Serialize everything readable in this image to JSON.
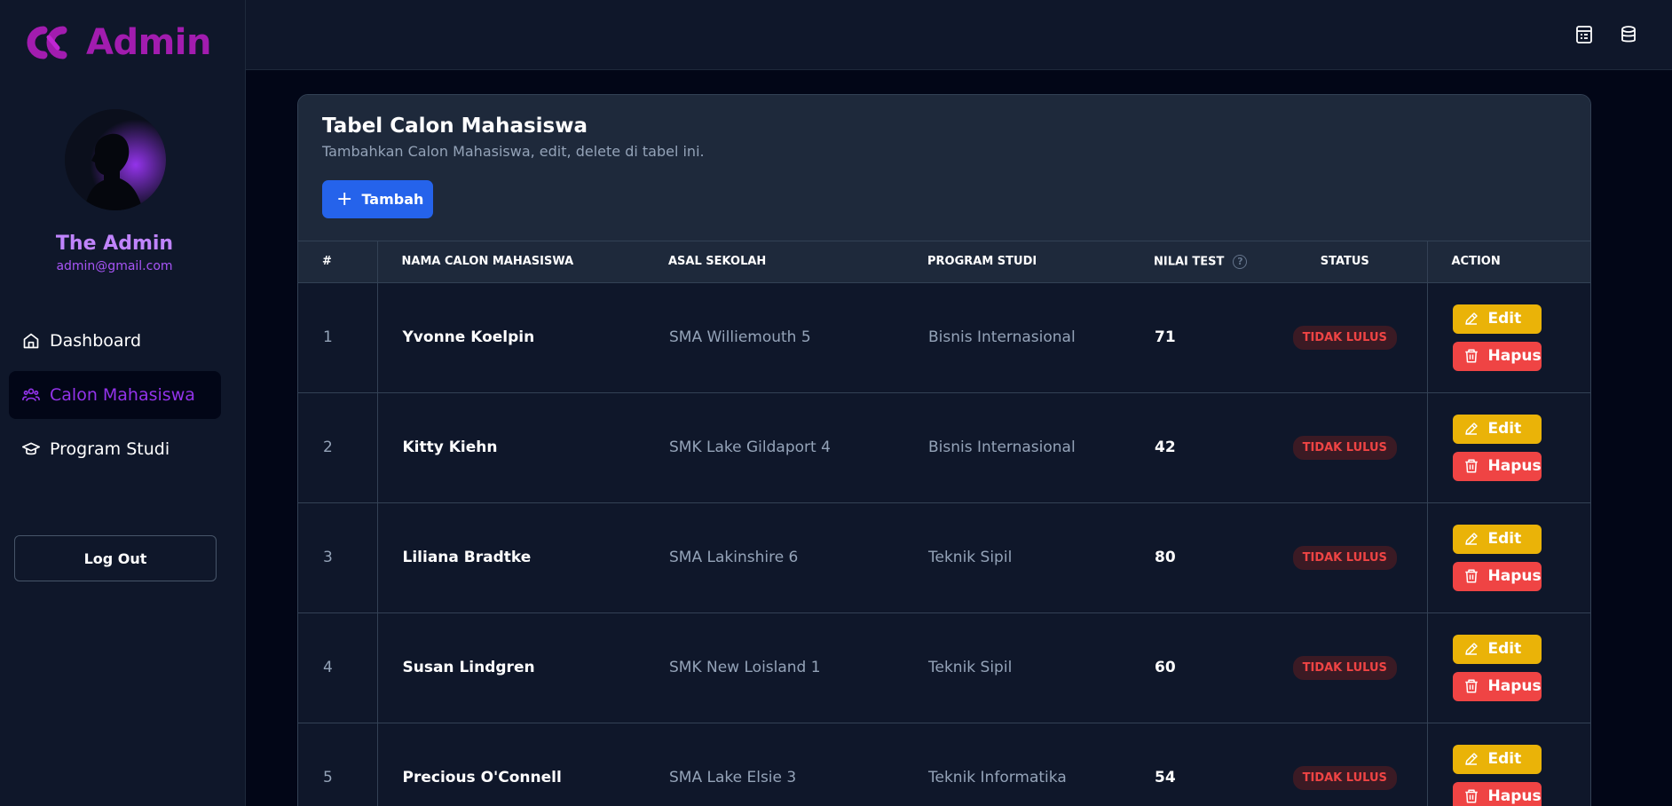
{
  "app": {
    "logo_text": "Admin"
  },
  "profile": {
    "name": "The Admin",
    "email": "admin@gmail.com"
  },
  "nav": [
    {
      "label": "Dashboard",
      "icon": "home-icon"
    },
    {
      "label": "Calon Mahasiswa",
      "icon": "users-icon",
      "active": true
    },
    {
      "label": "Program Studi",
      "icon": "graduation-cap-icon"
    }
  ],
  "logout_label": "Log Out",
  "topbar_icons": [
    "calendar-list-icon",
    "database-icon"
  ],
  "card": {
    "title": "Tabel Calon Mahasiswa",
    "subtitle": "Tambahkan Calon Mahasiswa, edit, delete di tabel ini.",
    "add_label": "Tambah"
  },
  "table": {
    "headers": {
      "num": "#",
      "name": "NAMA CALON MAHASISWA",
      "school": "ASAL SEKOLAH",
      "program": "PROGRAM STUDI",
      "score": "NILAI TEST",
      "status": "STATUS",
      "action": "ACTION"
    },
    "edit_label": "Edit",
    "delete_label": "Hapus",
    "rows": [
      {
        "num": "1",
        "name": "Yvonne Koelpin",
        "school": "SMA Williemouth 5",
        "program": "Bisnis Internasional",
        "score": "71",
        "status": "TIDAK LULUS"
      },
      {
        "num": "2",
        "name": "Kitty Kiehn",
        "school": "SMK Lake Gildaport 4",
        "program": "Bisnis Internasional",
        "score": "42",
        "status": "TIDAK LULUS"
      },
      {
        "num": "3",
        "name": "Liliana Bradtke",
        "school": "SMA Lakinshire 6",
        "program": "Teknik Sipil",
        "score": "80",
        "status": "TIDAK LULUS"
      },
      {
        "num": "4",
        "name": "Susan Lindgren",
        "school": "SMK New Loisland 1",
        "program": "Teknik Sipil",
        "score": "60",
        "status": "TIDAK LULUS"
      },
      {
        "num": "5",
        "name": "Precious O'Connell",
        "school": "SMA Lake Elsie 3",
        "program": "Teknik Informatika",
        "score": "54",
        "status": "TIDAK LULUS"
      }
    ]
  },
  "colors": {
    "accent": "#a21caf",
    "primary_button": "#2563eb",
    "edit_button": "#eab308",
    "delete_button": "#ef4444",
    "badge_text": "#ef4444"
  }
}
